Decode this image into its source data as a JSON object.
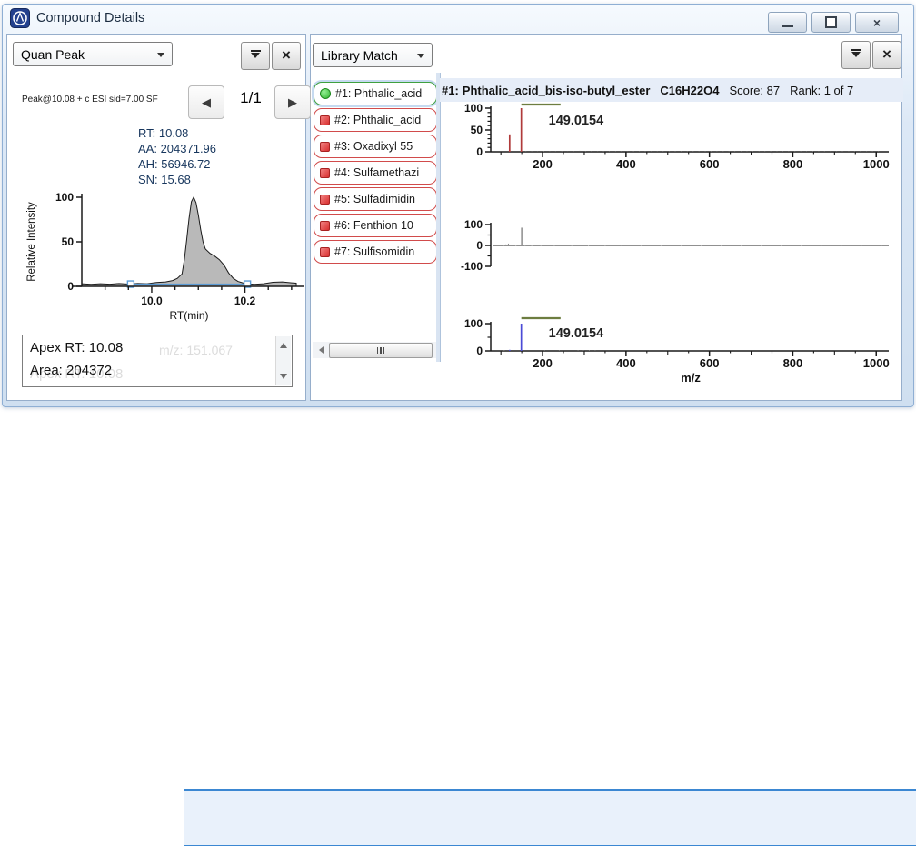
{
  "window": {
    "title": "Compound Details",
    "controls": {
      "minimize": "minimize",
      "restore": "restore",
      "close": "close",
      "close_glyph": "×"
    }
  },
  "left_panel": {
    "view_selector": {
      "value": "Quan Peak"
    },
    "toolbar": {
      "collapse_button": "collapse",
      "close_button": "close",
      "close_glyph": "×"
    },
    "pager": {
      "current": "1/1",
      "prev": "◀",
      "next": "▶"
    },
    "scan_header": "Peak@10.08 + c ESI sid=7.00  SF",
    "peak_annotations": [
      "RT: 10.08",
      "AA: 204371.96",
      "AH: 56946.72",
      "SN: 15.68"
    ],
    "info_box": {
      "lines": [
        "Apex RT: 10.08",
        "Area: 204372"
      ],
      "ghost_lines": [
        "m/z: 151.067",
        "Apex RT: 10.08"
      ]
    }
  },
  "right_panel": {
    "view_selector": {
      "value": "Library Match"
    },
    "toolbar": {
      "collapse_button": "collapse",
      "close_button": "close",
      "close_glyph": "×"
    },
    "match_header": {
      "prefix": "#1:",
      "name": "Phthalic_acid_bis-iso-butyl_ester",
      "formula": "C16H22O4",
      "score": "Score: 87",
      "rank": "Rank: 1 of 7"
    },
    "library_list": [
      {
        "label": "#1: Phthalic_acid",
        "status": "green"
      },
      {
        "label": "#2: Phthalic_acid",
        "status": "red"
      },
      {
        "label": "#3: Oxadixyl 55",
        "status": "red"
      },
      {
        "label": "#4: Sulfamethazi",
        "status": "red"
      },
      {
        "label": "#5: Sulfadimidin",
        "status": "red"
      },
      {
        "label": "#6: Fenthion 10",
        "status": "red"
      },
      {
        "label": "#7: Sulfisomidin",
        "status": "red"
      }
    ]
  },
  "colors": {
    "measured_peak": "#b03b3b",
    "library_peak": "#4b4bd6",
    "difference_peak": "#9a9a9a",
    "range_bar": "#6d7d40",
    "chromatogram_fill": "#b9b9b9",
    "baseline_marker": "#5b9bd5",
    "selected_border": "#3fa03f",
    "unselected_border": "#d14b4b",
    "highlight_panel_border": "#3b87d2"
  },
  "chart_data": [
    {
      "type": "area",
      "name": "chromatogram",
      "xlabel": "RT(min)",
      "ylabel": "Relative Intensity",
      "xlim": [
        9.85,
        10.31
      ],
      "ylim": [
        0,
        100
      ],
      "x_major_ticks": [
        10.0,
        10.2
      ],
      "x_minor_step": 0.05,
      "y_ticks": [
        0,
        50,
        100
      ],
      "apex_rt": 10.08,
      "fill_color": "#b9b9b9",
      "baseline": {
        "from": 9.955,
        "to": 10.205,
        "y": 2.5,
        "color": "#5b9bd5"
      },
      "points": [
        [
          9.85,
          3
        ],
        [
          9.87,
          2.2
        ],
        [
          9.89,
          3
        ],
        [
          9.91,
          2.4
        ],
        [
          9.93,
          3.2
        ],
        [
          9.95,
          2.6
        ],
        [
          9.97,
          3.4
        ],
        [
          9.99,
          3
        ],
        [
          10.01,
          4.4
        ],
        [
          10.03,
          5
        ],
        [
          10.045,
          6.5
        ],
        [
          10.055,
          9
        ],
        [
          10.065,
          14
        ],
        [
          10.07,
          30
        ],
        [
          10.075,
          52
        ],
        [
          10.08,
          76
        ],
        [
          10.085,
          95
        ],
        [
          10.09,
          100
        ],
        [
          10.095,
          94
        ],
        [
          10.1,
          80
        ],
        [
          10.105,
          64
        ],
        [
          10.11,
          50
        ],
        [
          10.115,
          42
        ],
        [
          10.125,
          37
        ],
        [
          10.135,
          34
        ],
        [
          10.145,
          30
        ],
        [
          10.155,
          24
        ],
        [
          10.165,
          15
        ],
        [
          10.175,
          9
        ],
        [
          10.185,
          5.5
        ],
        [
          10.195,
          4
        ],
        [
          10.205,
          3
        ],
        [
          10.22,
          2.2
        ],
        [
          10.24,
          3
        ],
        [
          10.26,
          4.6
        ],
        [
          10.28,
          5
        ],
        [
          10.3,
          4
        ],
        [
          10.31,
          3.6
        ]
      ]
    },
    {
      "type": "bar",
      "name": "measured-spectrum",
      "color": "#b03b3b",
      "xlim": [
        80,
        1030
      ],
      "ylim": [
        0,
        100
      ],
      "x_major_ticks": [
        200,
        400,
        600,
        800,
        1000
      ],
      "x_minor_step": 50,
      "y_ticks": [
        0,
        50,
        100
      ],
      "y_minor_step": 10,
      "peaks": [
        [
          121,
          40
        ],
        [
          149,
          100
        ]
      ],
      "peak_label": {
        "text": "149.0154",
        "mz": 149
      },
      "range_bar": {
        "from": 149,
        "to": 243,
        "color": "#6d7d40"
      },
      "noise": [
        [
          160,
          1.2
        ],
        [
          174,
          0.8
        ],
        [
          188,
          1.5
        ],
        [
          203,
          1.0
        ],
        [
          217,
          0.7
        ],
        [
          231,
          1.4
        ],
        [
          246,
          0.9
        ],
        [
          260,
          1.8
        ],
        [
          274,
          1.0
        ],
        [
          289,
          2.2
        ],
        [
          303,
          1.2
        ],
        [
          317,
          0.8
        ],
        [
          332,
          1.5
        ],
        [
          346,
          1.0
        ],
        [
          360,
          0.8
        ],
        [
          375,
          1.3
        ],
        [
          389,
          0.9
        ],
        [
          403,
          1.6
        ],
        [
          418,
          1.0
        ],
        [
          432,
          0.8
        ],
        [
          446,
          1.2
        ],
        [
          461,
          0.9
        ],
        [
          475,
          1.4
        ],
        [
          489,
          1.0
        ],
        [
          504,
          0.8
        ],
        [
          518,
          1.2
        ],
        [
          532,
          0.9
        ],
        [
          547,
          1.3
        ],
        [
          561,
          1.0
        ],
        [
          575,
          0.8
        ],
        [
          590,
          1.2
        ],
        [
          604,
          0.9
        ],
        [
          618,
          1.3
        ],
        [
          633,
          1.0
        ],
        [
          647,
          0.8
        ],
        [
          661,
          1.2
        ],
        [
          676,
          0.9
        ],
        [
          690,
          1.3
        ],
        [
          704,
          1.0
        ],
        [
          719,
          0.8
        ],
        [
          733,
          1.2
        ],
        [
          747,
          0.9
        ],
        [
          762,
          1.3
        ],
        [
          776,
          1.0
        ],
        [
          790,
          0.8
        ],
        [
          805,
          1.2
        ],
        [
          819,
          0.9
        ],
        [
          833,
          1.3
        ],
        [
          848,
          1.0
        ],
        [
          862,
          0.8
        ],
        [
          876,
          1.2
        ],
        [
          891,
          0.9
        ],
        [
          905,
          1.3
        ],
        [
          919,
          1.0
        ],
        [
          934,
          0.8
        ],
        [
          948,
          1.2
        ],
        [
          962,
          0.9
        ],
        [
          977,
          1.3
        ],
        [
          991,
          1.0
        ],
        [
          1005,
          0.8
        ]
      ]
    },
    {
      "type": "bar",
      "name": "difference-spectrum",
      "color": "#9a9a9a",
      "xlim": [
        80,
        1030
      ],
      "ylim": [
        -100,
        100
      ],
      "y_ticks": [
        -100,
        0,
        100
      ],
      "y_minor_step": 50,
      "peaks": [
        [
          150,
          85
        ]
      ],
      "noise": [
        [
          100,
          3
        ],
        [
          106,
          -2
        ],
        [
          112,
          5
        ],
        [
          118,
          9
        ],
        [
          124,
          -4
        ],
        [
          130,
          3
        ],
        [
          136,
          -2
        ],
        [
          145,
          4
        ],
        [
          158,
          -3
        ],
        [
          166,
          2
        ],
        [
          174,
          -2
        ],
        [
          184,
          2
        ],
        [
          196,
          -1.5
        ],
        [
          210,
          1.5
        ],
        [
          228,
          -1.5
        ],
        [
          250,
          2
        ],
        [
          270,
          -1.5
        ],
        [
          290,
          2.5
        ],
        [
          310,
          -2
        ],
        [
          330,
          2
        ],
        [
          350,
          -1.5
        ],
        [
          370,
          1.5
        ],
        [
          390,
          -1.5
        ],
        [
          412,
          1.8
        ],
        [
          436,
          -1.5
        ],
        [
          460,
          1.5
        ],
        [
          484,
          -1.5
        ],
        [
          508,
          1.5
        ],
        [
          532,
          -1.5
        ],
        [
          556,
          1.5
        ],
        [
          580,
          -1.5
        ],
        [
          604,
          1.5
        ],
        [
          628,
          -1.5
        ],
        [
          652,
          1.5
        ],
        [
          676,
          -1.5
        ],
        [
          700,
          1.5
        ],
        [
          724,
          -1.5
        ],
        [
          748,
          1.5
        ],
        [
          772,
          -1.5
        ],
        [
          796,
          1.5
        ],
        [
          820,
          -1.5
        ],
        [
          844,
          1.5
        ],
        [
          868,
          -1.5
        ],
        [
          892,
          1.5
        ],
        [
          916,
          -1.5
        ],
        [
          940,
          1.5
        ],
        [
          964,
          -1.5
        ],
        [
          988,
          1.5
        ],
        [
          1012,
          -1.5
        ]
      ]
    },
    {
      "type": "bar",
      "name": "library-spectrum",
      "color": "#4b4bd6",
      "xlim": [
        80,
        1030
      ],
      "ylim": [
        0,
        100
      ],
      "x_major_ticks": [
        200,
        400,
        600,
        800,
        1000
      ],
      "x_minor_step": 50,
      "y_ticks": [
        0,
        100
      ],
      "y_minor_step": 50,
      "xlabel": "m/z",
      "peaks": [
        [
          121,
          4
        ],
        [
          149,
          100
        ]
      ],
      "peak_label": {
        "text": "149.0154",
        "mz": 149
      },
      "range_bar": {
        "from": 149,
        "to": 243,
        "color": "#6d7d40"
      },
      "noise": [
        [
          108,
          1.2
        ],
        [
          205,
          0.8
        ],
        [
          240,
          1.0
        ],
        [
          285,
          1.0
        ],
        [
          298,
          0.8
        ],
        [
          312,
          1.2
        ],
        [
          326,
          0.7
        ]
      ]
    }
  ]
}
